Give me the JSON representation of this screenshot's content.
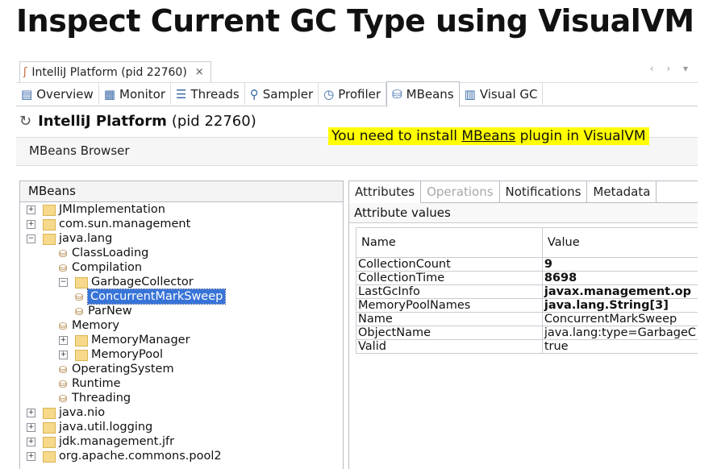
{
  "slide": {
    "title": "Inspect Current GC Type using VisualVM"
  },
  "doc_tab": {
    "label": "IntelliJ Platform (pid 22760)",
    "close": "×",
    "icon": "app-icon"
  },
  "view_tabs": [
    {
      "label": "Overview",
      "icon": "overview-icon"
    },
    {
      "label": "Monitor",
      "icon": "monitor-icon"
    },
    {
      "label": "Threads",
      "icon": "threads-icon"
    },
    {
      "label": "Sampler",
      "icon": "sampler-icon"
    },
    {
      "label": "Profiler",
      "icon": "profiler-icon"
    },
    {
      "label": "MBeans",
      "icon": "mbeans-icon"
    },
    {
      "label": "Visual GC",
      "icon": "visualgc-icon"
    }
  ],
  "header": {
    "name": "IntelliJ Platform",
    "pid": "(pid 22760)"
  },
  "banner": {
    "before": "You need to install ",
    "link": "MBeans",
    "after": " plugin in VisualVM"
  },
  "browser_title": "MBeans Browser",
  "left_panel": {
    "title": "MBeans",
    "tree": [
      {
        "label": "JMImplementation",
        "level": 0,
        "type": "folder",
        "expander": "+"
      },
      {
        "label": "com.sun.management",
        "level": 0,
        "type": "folder",
        "expander": "+"
      },
      {
        "label": "java.lang",
        "level": 0,
        "type": "folder",
        "expander": "−"
      },
      {
        "label": "ClassLoading",
        "level": 1,
        "type": "bean"
      },
      {
        "label": "Compilation",
        "level": 1,
        "type": "bean"
      },
      {
        "label": "GarbageCollector",
        "level": 1,
        "type": "folder",
        "expander": "−"
      },
      {
        "label": "ConcurrentMarkSweep",
        "level": 2,
        "type": "bean",
        "selected": true
      },
      {
        "label": "ParNew",
        "level": 2,
        "type": "bean"
      },
      {
        "label": "Memory",
        "level": 1,
        "type": "bean"
      },
      {
        "label": "MemoryManager",
        "level": 1,
        "type": "folder",
        "expander": "+"
      },
      {
        "label": "MemoryPool",
        "level": 1,
        "type": "folder",
        "expander": "+"
      },
      {
        "label": "OperatingSystem",
        "level": 1,
        "type": "bean"
      },
      {
        "label": "Runtime",
        "level": 1,
        "type": "bean"
      },
      {
        "label": "Threading",
        "level": 1,
        "type": "bean"
      },
      {
        "label": "java.nio",
        "level": 0,
        "type": "folder",
        "expander": "+"
      },
      {
        "label": "java.util.logging",
        "level": 0,
        "type": "folder",
        "expander": "+"
      },
      {
        "label": "jdk.management.jfr",
        "level": 0,
        "type": "folder",
        "expander": "+"
      },
      {
        "label": "org.apache.commons.pool2",
        "level": 0,
        "type": "folder",
        "expander": "+"
      }
    ]
  },
  "right_panel": {
    "tabs": [
      {
        "label": "Attributes",
        "state": "active"
      },
      {
        "label": "Operations",
        "state": "disabled"
      },
      {
        "label": "Notifications",
        "state": "normal"
      },
      {
        "label": "Metadata",
        "state": "normal"
      }
    ],
    "section_title": "Attribute values",
    "columns": {
      "name": "Name",
      "value": "Value"
    },
    "rows": [
      {
        "name": "CollectionCount",
        "value": "9",
        "bold": true
      },
      {
        "name": "CollectionTime",
        "value": "8698",
        "bold": true
      },
      {
        "name": "LastGcInfo",
        "value": "javax.management.op",
        "bold": true
      },
      {
        "name": "MemoryPoolNames",
        "value": "java.lang.String[3]",
        "bold": true
      },
      {
        "name": "Name",
        "value": "ConcurrentMarkSweep",
        "bold": false
      },
      {
        "name": "ObjectName",
        "value": "java.lang:type=GarbageC",
        "bold": false
      },
      {
        "name": "Valid",
        "value": "true",
        "bold": false
      }
    ]
  }
}
